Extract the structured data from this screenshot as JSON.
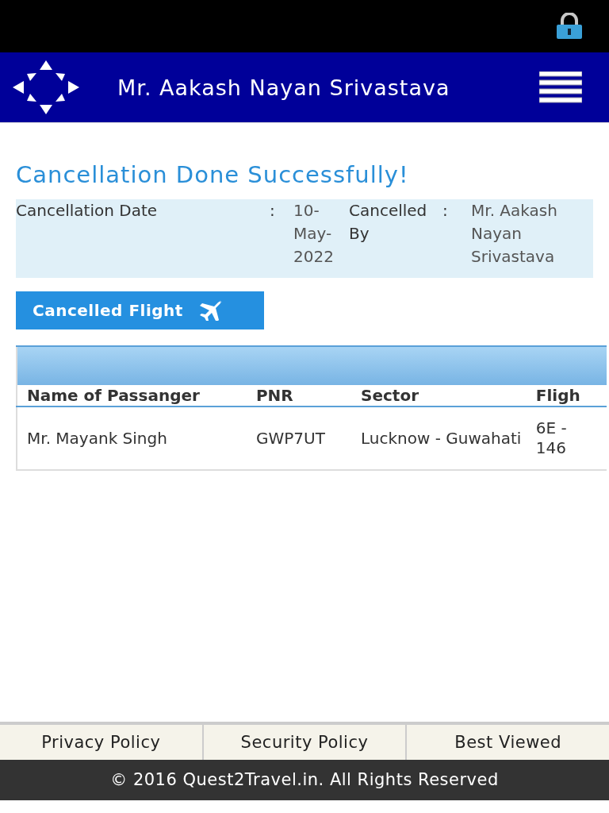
{
  "header": {
    "title": "Mr. Aakash Nayan Srivastava"
  },
  "heading": "Cancellation Done Successfully!",
  "details": [
    {
      "label": "Cancellation Date",
      "separator": ":",
      "value": "10-May-2022"
    },
    {
      "label": "Cancelled By",
      "separator": ":",
      "value": "Mr. Aakash Nayan Srivastava"
    }
  ],
  "section_button": {
    "label": "Cancelled Flight"
  },
  "table": {
    "columns": [
      "Name of Passanger",
      "PNR",
      "Sector",
      "Fligh"
    ],
    "rows": [
      [
        "Mr. Mayank Singh",
        "GWP7UT",
        "Lucknow - Guwahati",
        "6E - 146"
      ]
    ]
  },
  "footer": {
    "links": [
      "Privacy Policy",
      "Security Policy",
      "Best Viewed"
    ],
    "copyright": "© 2016 Quest2Travel.in. All Rights Reserved"
  }
}
